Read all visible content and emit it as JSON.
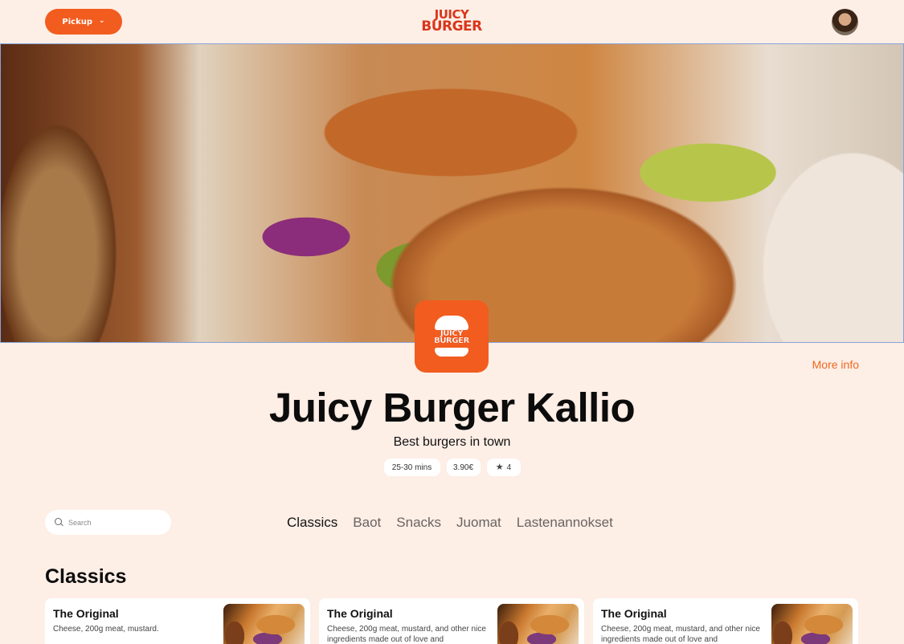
{
  "header": {
    "pickup_label": "Pickup",
    "brand_line1": "JUICY",
    "brand_line2": "BURGER"
  },
  "hero": {
    "image_alt": ""
  },
  "restaurant": {
    "logo_text": "JUICY BURGER",
    "name": "Juicy Burger Kallio",
    "tagline": "Best burgers in town",
    "more_info_label": "More info",
    "delivery_time": "25-30 mins",
    "delivery_fee": "3.90€",
    "rating": "4"
  },
  "search": {
    "placeholder": "Search",
    "value": ""
  },
  "tabs": [
    {
      "label": "Classics",
      "active": true
    },
    {
      "label": "Baot",
      "active": false
    },
    {
      "label": "Snacks",
      "active": false
    },
    {
      "label": "Juomat",
      "active": false
    },
    {
      "label": "Lastenannokset",
      "active": false
    }
  ],
  "section": {
    "title": "Classics"
  },
  "menu_items": [
    {
      "name": "The Original",
      "description": "Cheese, 200g meat, mustard."
    },
    {
      "name": "The Original",
      "description": "Cheese, 200g meat, mustard, and other nice ingredients made out of love and"
    },
    {
      "name": "The Original",
      "description": "Cheese, 200g meat, mustard, and other nice ingredients made out of love and"
    }
  ],
  "colors": {
    "accent": "#f25c1e",
    "brand": "#d9361b",
    "background": "#fdeee6",
    "more_info": "#f0681f"
  },
  "icons": {
    "pickup_chevron": "chevron-down-icon",
    "rating": "star-icon",
    "search": "search-icon"
  }
}
